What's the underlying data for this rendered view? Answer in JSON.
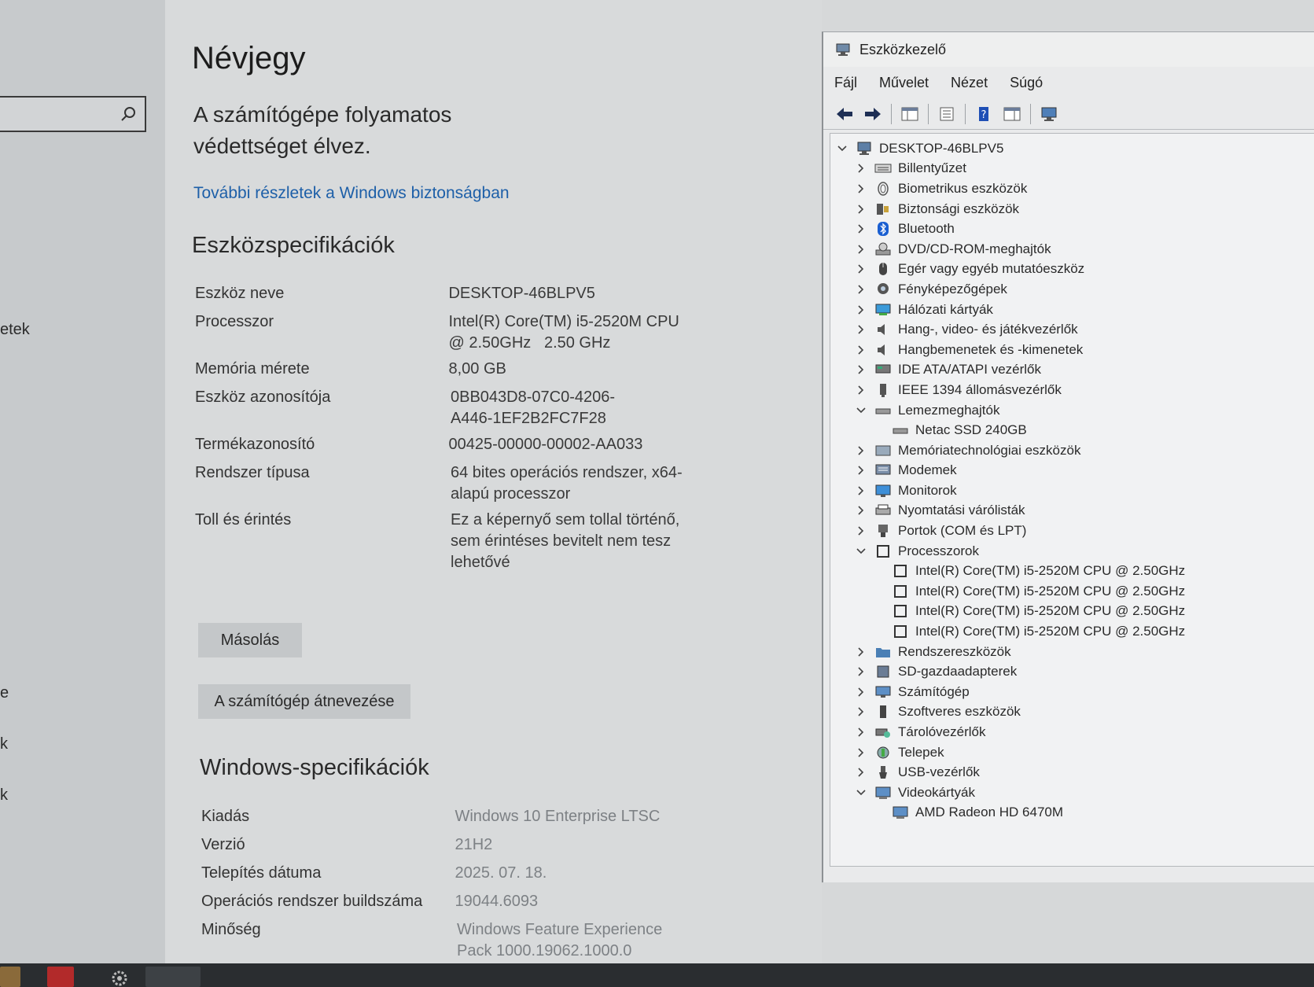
{
  "left_nav": {
    "fragments": [
      "etek",
      "e",
      "k",
      "k"
    ]
  },
  "settings": {
    "title": "Névjegy",
    "protection_text": "A számítógépe folyamatos védettséget élvez.",
    "security_link": "További részletek a Windows biztonságban",
    "device_specs": {
      "heading": "Eszközspecifikációk",
      "rows": [
        {
          "label": "Eszköz neve",
          "value": "DESKTOP-46BLPV5"
        },
        {
          "label": "Processzor",
          "value": "Intel(R) Core(TM) i5-2520M CPU @ 2.50GHz   2.50 GHz"
        },
        {
          "label": "Memória mérete",
          "value": "8,00 GB"
        },
        {
          "label": "Eszköz azonosítója",
          "value": "0BB043D8-07C0-4206-A446-1EF2B2FC7F28"
        },
        {
          "label": "Termékazonosító",
          "value": "00425-00000-00002-AA033"
        },
        {
          "label": "Rendszer típusa",
          "value": "64 bites operációs rendszer, x64-alapú processzor"
        },
        {
          "label": "Toll és érintés",
          "value": "Ez a képernyő sem tollal történő, sem érintéses bevitelt nem tesz lehetővé"
        }
      ],
      "copy_button": "Másolás",
      "rename_button": "A számítógép átnevezése"
    },
    "windows_specs": {
      "heading": "Windows-specifikációk",
      "rows": [
        {
          "label": "Kiadás",
          "value": "Windows 10 Enterprise LTSC"
        },
        {
          "label": "Verzió",
          "value": "21H2"
        },
        {
          "label": "Telepítés dátuma",
          "value": "2025. 07. 18."
        },
        {
          "label": "Operációs rendszer buildszáma",
          "value": "19044.6093"
        },
        {
          "label": "Minőség",
          "value": "Windows Feature Experience Pack 1000.19062.1000.0"
        }
      ]
    }
  },
  "device_manager": {
    "title": "Eszközkezelő",
    "menu": [
      "Fájl",
      "Művelet",
      "Nézet",
      "Súgó"
    ],
    "tree": {
      "root": "DESKTOP-46BLPV5",
      "items": [
        {
          "label": "Billentyűzet",
          "icon": "keyboard-icon",
          "expanded": false
        },
        {
          "label": "Biometrikus eszközök",
          "icon": "fingerprint-icon",
          "expanded": false
        },
        {
          "label": "Biztonsági eszközök",
          "icon": "security-key-icon",
          "expanded": false
        },
        {
          "label": "Bluetooth",
          "icon": "bluetooth-icon",
          "expanded": false
        },
        {
          "label": "DVD/CD-ROM-meghajtók",
          "icon": "disc-drive-icon",
          "expanded": false
        },
        {
          "label": "Egér vagy egyéb mutatóeszköz",
          "icon": "mouse-icon",
          "expanded": false
        },
        {
          "label": "Fényképezőgépek",
          "icon": "camera-icon",
          "expanded": false
        },
        {
          "label": "Hálózati kártyák",
          "icon": "network-icon",
          "expanded": false
        },
        {
          "label": "Hang-, video- és játékvezérlők",
          "icon": "speaker-icon",
          "expanded": false
        },
        {
          "label": "Hangbemenetek és -kimenetek",
          "icon": "speaker-icon",
          "expanded": false
        },
        {
          "label": "IDE ATA/ATAPI vezérlők",
          "icon": "ide-controller-icon",
          "expanded": false
        },
        {
          "label": "IEEE 1394 állomásvezérlők",
          "icon": "firewire-icon",
          "expanded": false
        },
        {
          "label": "Lemezmeghajtók",
          "icon": "disk-icon",
          "expanded": true,
          "children": [
            "Netac SSD 240GB"
          ]
        },
        {
          "label": "Memóriatechnológiai eszközök",
          "icon": "memory-icon",
          "expanded": false
        },
        {
          "label": "Modemek",
          "icon": "modem-icon",
          "expanded": false
        },
        {
          "label": "Monitorok",
          "icon": "monitor-icon",
          "expanded": false
        },
        {
          "label": "Nyomtatási várólisták",
          "icon": "printer-icon",
          "expanded": false
        },
        {
          "label": "Portok (COM és LPT)",
          "icon": "port-icon",
          "expanded": false
        },
        {
          "label": "Processzorok",
          "icon": "cpu-icon",
          "expanded": true,
          "children": [
            "Intel(R) Core(TM) i5-2520M CPU @ 2.50GHz",
            "Intel(R) Core(TM) i5-2520M CPU @ 2.50GHz",
            "Intel(R) Core(TM) i5-2520M CPU @ 2.50GHz",
            "Intel(R) Core(TM) i5-2520M CPU @ 2.50GHz"
          ]
        },
        {
          "label": "Rendszereszközök",
          "icon": "folder-icon",
          "expanded": false
        },
        {
          "label": "SD-gazdaadapterek",
          "icon": "sd-card-icon",
          "expanded": false
        },
        {
          "label": "Számítógép",
          "icon": "computer-icon",
          "expanded": false
        },
        {
          "label": "Szoftveres eszközök",
          "icon": "software-device-icon",
          "expanded": false
        },
        {
          "label": "Tárolóvezérlők",
          "icon": "storage-controller-icon",
          "expanded": false
        },
        {
          "label": "Telepek",
          "icon": "battery-icon",
          "expanded": false
        },
        {
          "label": "USB-vezérlők",
          "icon": "usb-icon",
          "expanded": false
        },
        {
          "label": "Videokártyák",
          "icon": "display-adapter-icon",
          "expanded": true,
          "children": [
            "AMD Radeon HD 6470M"
          ]
        }
      ]
    }
  },
  "colors": {
    "link": "#1d5fa8",
    "background": "#d8dadb",
    "taskbar": "#2a2d30"
  }
}
